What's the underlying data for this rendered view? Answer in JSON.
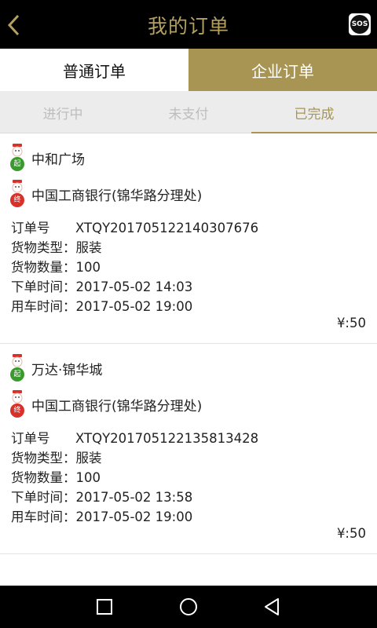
{
  "header": {
    "title": "我的订单",
    "back_icon": "chevron-left-icon",
    "sos_label": "SOS"
  },
  "main_tabs": [
    {
      "label": "普通订单",
      "active": false
    },
    {
      "label": "企业订单",
      "active": true
    }
  ],
  "sub_tabs": [
    {
      "label": "进行中",
      "active": false
    },
    {
      "label": "未支付",
      "active": false
    },
    {
      "label": "已完成",
      "active": true
    }
  ],
  "pin_labels": {
    "start": "起",
    "end": "终"
  },
  "orders": [
    {
      "start": "中和广场",
      "end": "中国工商银行(锦华路分理处)",
      "order_no_label": "订单号",
      "order_no": "XTQY20170512214030767​6",
      "cargo_type_label": "货物类型：",
      "cargo_type": "服装",
      "cargo_qty_label": "货物数量：",
      "cargo_qty": "100",
      "order_time_label": "下单时间：",
      "order_time": "2017-05-02 14:03",
      "use_time_label": "用车时间：",
      "use_time": "2017-05-02 19:00",
      "price": "¥:50"
    },
    {
      "start": "万达·锦华城",
      "end": "中国工商银行(锦华路分理处)",
      "order_no_label": "订单号",
      "order_no": "XTQY20170512213581342​8",
      "cargo_type_label": "货物类型：",
      "cargo_type": "服装",
      "cargo_qty_label": "货物数量：",
      "cargo_qty": "100",
      "order_time_label": "下单时间：",
      "order_time": "2017-05-02 13:58",
      "use_time_label": "用车时间：",
      "use_time": "2017-05-02 19:00",
      "price": "¥:50"
    }
  ],
  "colors": {
    "gold": "#a99553",
    "title_gold": "#b3a061",
    "start_green": "#3b9a2e",
    "end_red": "#d8312a"
  }
}
